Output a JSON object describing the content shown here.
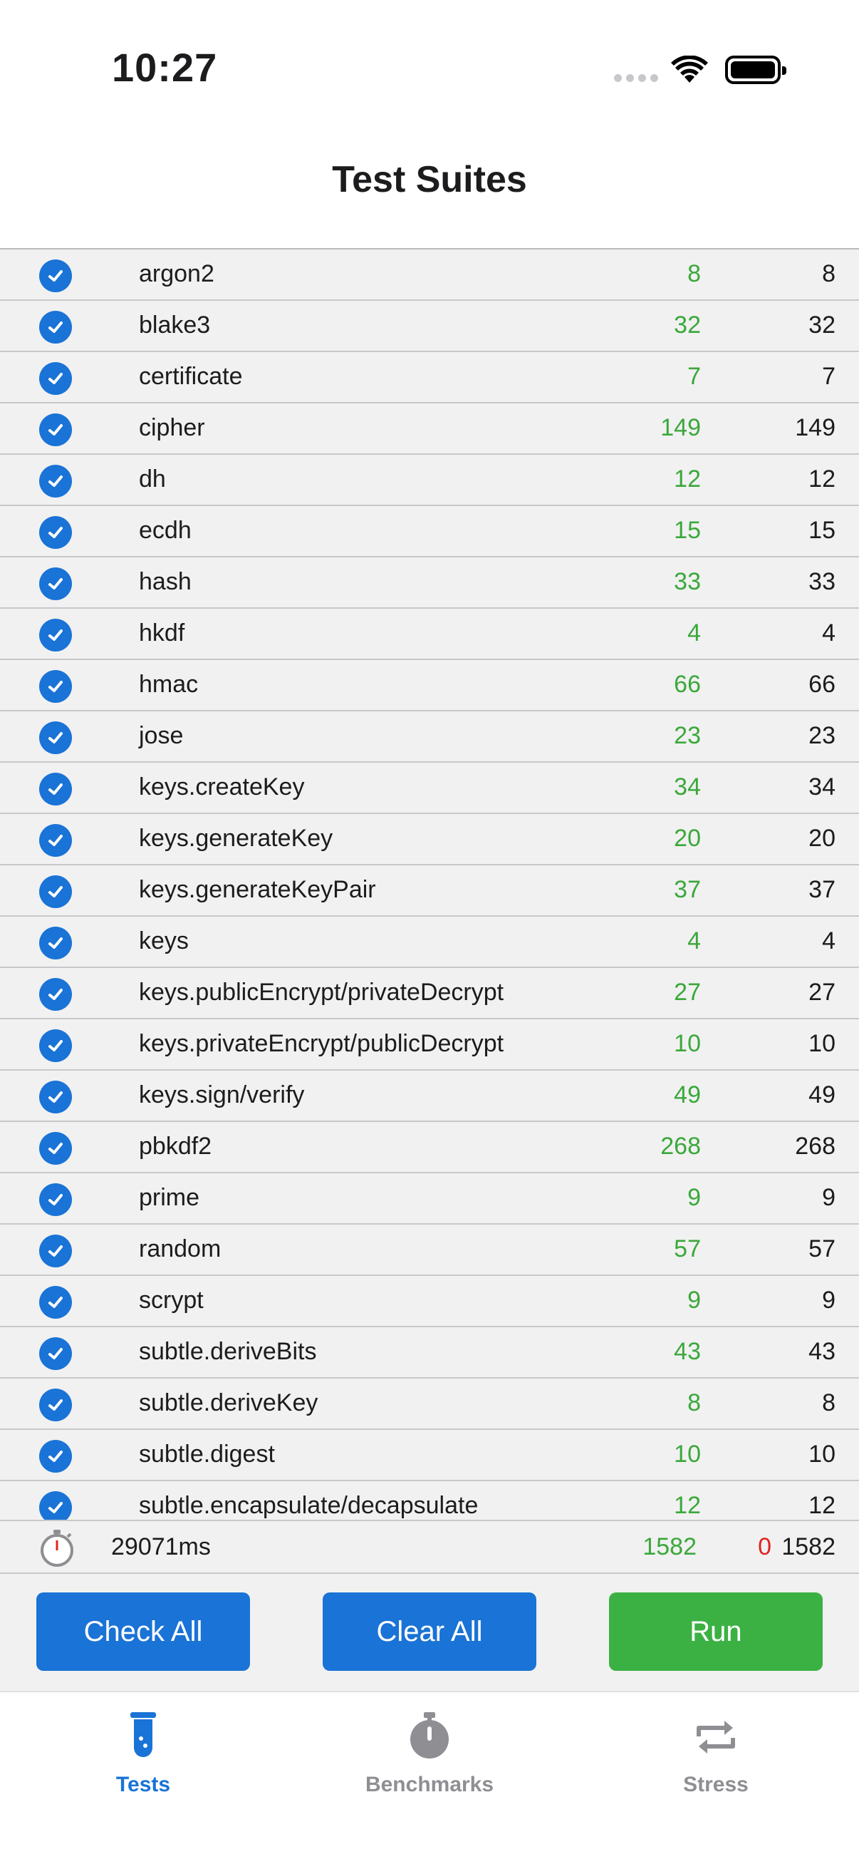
{
  "status_bar": {
    "time": "10:27"
  },
  "header": {
    "title": "Test Suites"
  },
  "suites": [
    {
      "name": "argon2",
      "passed": "8",
      "total": "8"
    },
    {
      "name": "blake3",
      "passed": "32",
      "total": "32"
    },
    {
      "name": "certificate",
      "passed": "7",
      "total": "7"
    },
    {
      "name": "cipher",
      "passed": "149",
      "total": "149"
    },
    {
      "name": "dh",
      "passed": "12",
      "total": "12"
    },
    {
      "name": "ecdh",
      "passed": "15",
      "total": "15"
    },
    {
      "name": "hash",
      "passed": "33",
      "total": "33"
    },
    {
      "name": "hkdf",
      "passed": "4",
      "total": "4"
    },
    {
      "name": "hmac",
      "passed": "66",
      "total": "66"
    },
    {
      "name": "jose",
      "passed": "23",
      "total": "23"
    },
    {
      "name": "keys.createKey",
      "passed": "34",
      "total": "34"
    },
    {
      "name": "keys.generateKey",
      "passed": "20",
      "total": "20"
    },
    {
      "name": "keys.generateKeyPair",
      "passed": "37",
      "total": "37"
    },
    {
      "name": "keys",
      "passed": "4",
      "total": "4"
    },
    {
      "name": "keys.publicEncrypt/privateDecrypt",
      "passed": "27",
      "total": "27"
    },
    {
      "name": "keys.privateEncrypt/publicDecrypt",
      "passed": "10",
      "total": "10"
    },
    {
      "name": "keys.sign/verify",
      "passed": "49",
      "total": "49"
    },
    {
      "name": "pbkdf2",
      "passed": "268",
      "total": "268"
    },
    {
      "name": "prime",
      "passed": "9",
      "total": "9"
    },
    {
      "name": "random",
      "passed": "57",
      "total": "57"
    },
    {
      "name": "scrypt",
      "passed": "9",
      "total": "9"
    },
    {
      "name": "subtle.deriveBits",
      "passed": "43",
      "total": "43"
    },
    {
      "name": "subtle.deriveKey",
      "passed": "8",
      "total": "8"
    },
    {
      "name": "subtle.digest",
      "passed": "10",
      "total": "10"
    },
    {
      "name": "subtle.encapsulate/decapsulate",
      "passed": "12",
      "total": "12"
    }
  ],
  "summary": {
    "elapsed": "29071ms",
    "passed": "1582",
    "failed": "0",
    "total": "1582"
  },
  "actions": {
    "check_all": "Check All",
    "clear_all": "Clear All",
    "run": "Run"
  },
  "tabs": [
    {
      "label": "Tests",
      "icon": "test-tube-icon",
      "active": true
    },
    {
      "label": "Benchmarks",
      "icon": "stopwatch-icon",
      "active": false
    },
    {
      "label": "Stress",
      "icon": "repeat-icon",
      "active": false
    }
  ],
  "colors": {
    "accent": "#1a73d6",
    "passed": "#3aa83a",
    "failed": "#e0241f",
    "run": "#3bb143",
    "tab_inactive": "#8e8e93"
  }
}
